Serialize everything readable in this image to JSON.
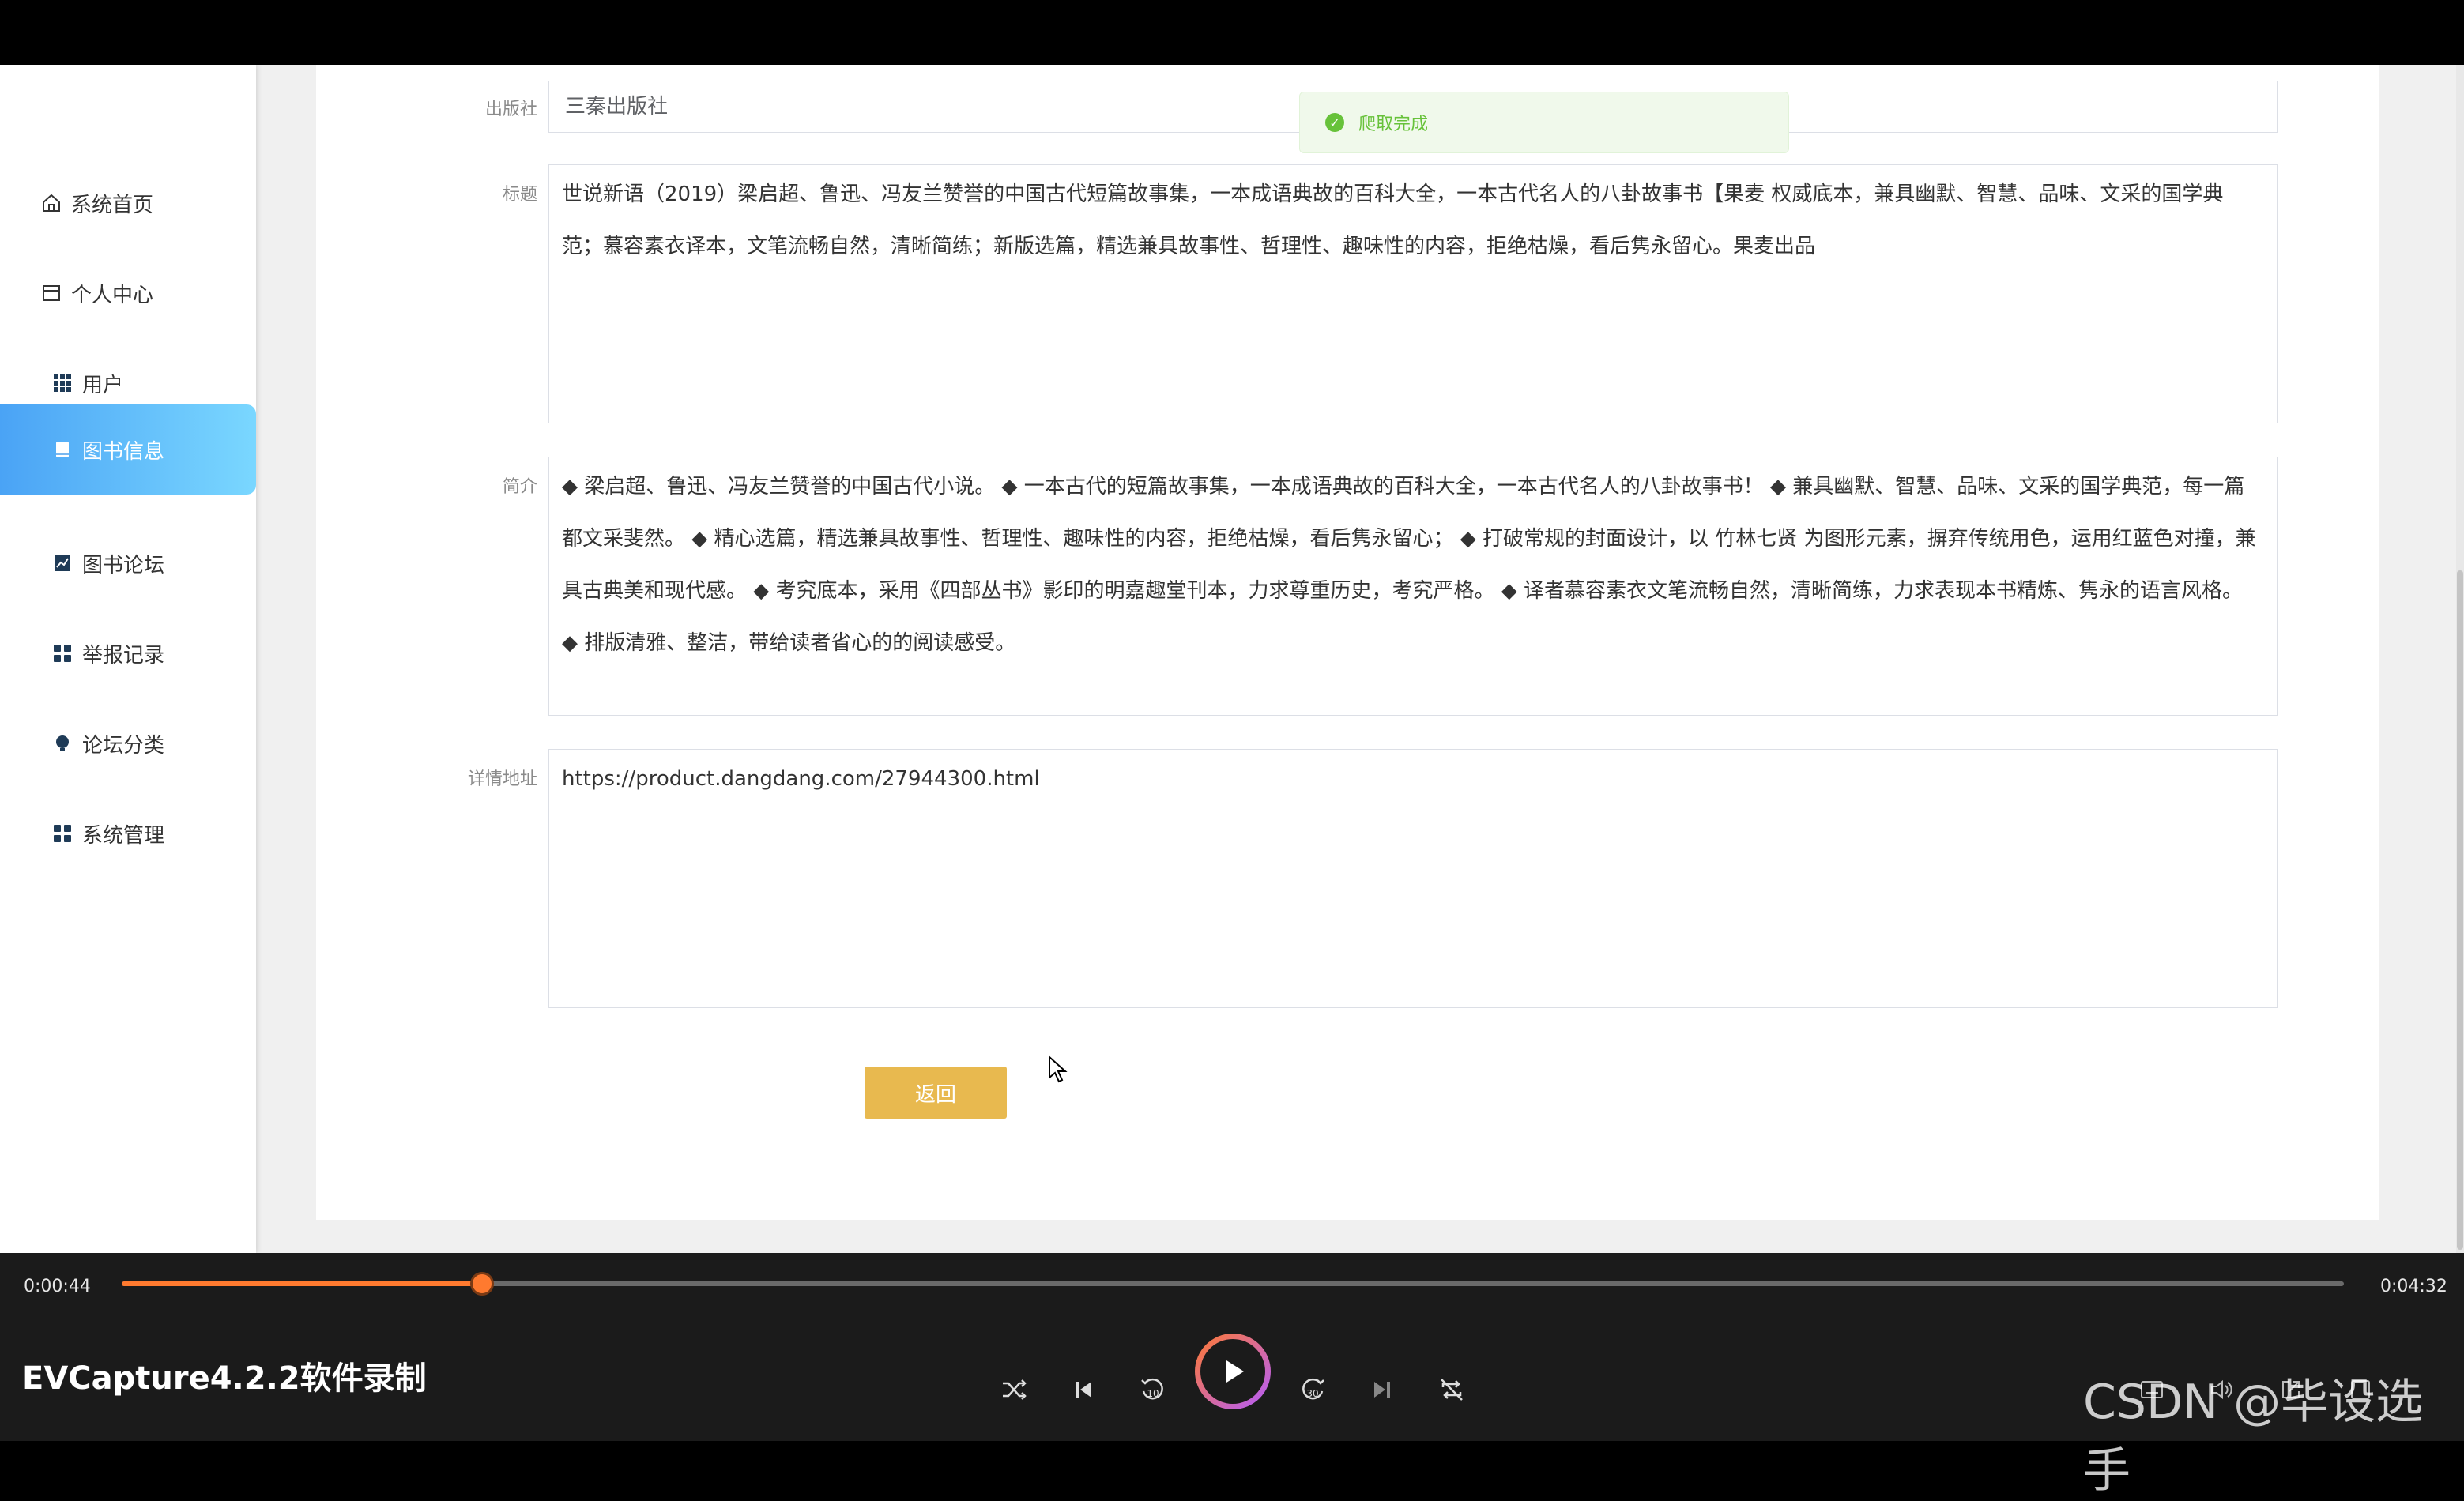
{
  "sidebar": {
    "items": [
      {
        "label": "系统首页",
        "icon": "home-icon"
      },
      {
        "label": "个人中心",
        "icon": "profile-icon"
      },
      {
        "label": "用户",
        "icon": "grid-icon"
      },
      {
        "label": "图书信息",
        "icon": "book-icon",
        "active": true
      },
      {
        "label": "图书论坛",
        "icon": "chart-icon"
      },
      {
        "label": "举报记录",
        "icon": "apps-icon"
      },
      {
        "label": "论坛分类",
        "icon": "bulb-icon"
      },
      {
        "label": "系统管理",
        "icon": "apps-icon"
      }
    ]
  },
  "toast": {
    "message": "爬取完成",
    "icon": "check-circle-icon"
  },
  "form": {
    "publisher_label": "出版社",
    "publisher_value": "三秦出版社",
    "title_label": "标题",
    "title_value": "世说新语（2019）梁启超、鲁迅、冯友兰赞誉的中国古代短篇故事集，一本成语典故的百科大全，一本古代名人的八卦故事书【果麦 权威底本，兼具幽默、智慧、品味、文采的国学典范；慕容素衣译本，文笔流畅自然，清晰简练；新版选篇，精选兼具故事性、哲理性、趣味性的内容，拒绝枯燥，看后隽永留心。果麦出品",
    "intro_label": "简介",
    "intro_value": "◆ 梁启超、鲁迅、冯友兰赞誉的中国古代小说。 ◆ 一本古代的短篇故事集，一本成语典故的百科大全，一本古代名人的八卦故事书！ ◆ 兼具幽默、智慧、品味、文采的国学典范，每一篇都文采斐然。 ◆ 精心选篇，精选兼具故事性、哲理性、趣味性的内容，拒绝枯燥，看后隽永留心； ◆ 打破常规的封面设计，以 竹林七贤 为图形元素，摒弃传统用色，运用红蓝色对撞，兼具古典美和现代感。 ◆ 考究底本，采用《四部丛书》影印的明嘉趣堂刊本，力求尊重历史，考究严格。 ◆ 译者慕容素衣文笔流畅自然，清晰简练，力求表现本书精炼、隽永的语言风格。 ◆ 排版清雅、整洁，带给读者省心的的阅读感受。",
    "url_label": "详情地址",
    "url_value": "https://product.dangdang.com/27944300.html",
    "back_button": "返回"
  },
  "player": {
    "current_time": "0:00:44",
    "total_time": "0:04:32",
    "progress": 0.162,
    "recorder_label": "EVCapture4.2.2软件录制",
    "watermark": "CSDN @毕设选手",
    "accent_color": "#ff7a2f"
  }
}
